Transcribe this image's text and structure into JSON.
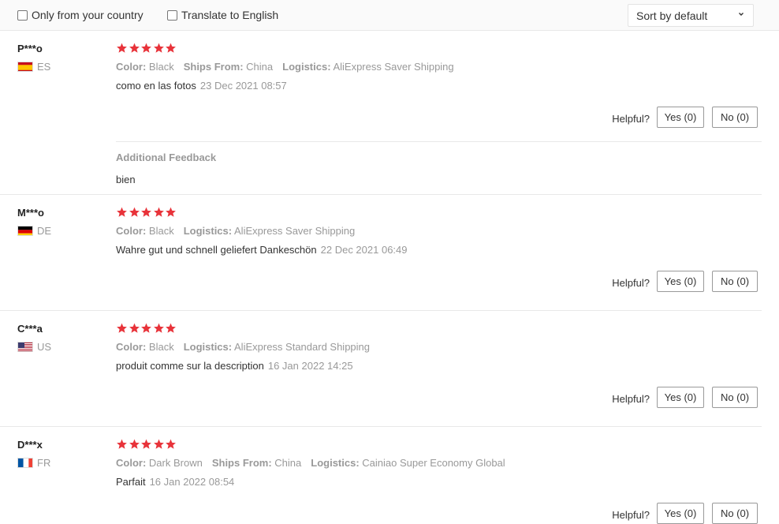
{
  "filters": {
    "only_country_label": "Only from your country",
    "translate_label": "Translate to English",
    "sort_value": "Sort by default"
  },
  "helpful_label": "Helpful?",
  "colors": {
    "star": "#e8333a",
    "muted": "#999999",
    "border": "#e8e8e8"
  },
  "reviews": [
    {
      "name": "P***o",
      "country": "ES",
      "flag_icon": "spain-flag-icon",
      "rating": 5,
      "attrs": [
        {
          "key": "Color:",
          "value": "Black"
        },
        {
          "key": "Ships From:",
          "value": "China"
        },
        {
          "key": "Logistics:",
          "value": "AliExpress Saver Shipping"
        }
      ],
      "text": "como en las fotos",
      "date": "23 Dec 2021 08:57",
      "yes": "Yes (0)",
      "no": "No (0)",
      "additional_title": "Additional Feedback",
      "additional_text": "bien"
    },
    {
      "name": "M***o",
      "country": "DE",
      "flag_icon": "germany-flag-icon",
      "rating": 5,
      "attrs": [
        {
          "key": "Color:",
          "value": "Black"
        },
        {
          "key": "Logistics:",
          "value": "AliExpress Saver Shipping"
        }
      ],
      "text": "Wahre gut und schnell geliefert Dankeschön",
      "date": "22 Dec 2021 06:49",
      "yes": "Yes (0)",
      "no": "No (0)"
    },
    {
      "name": "C***a",
      "country": "US",
      "flag_icon": "usa-flag-icon",
      "rating": 5,
      "attrs": [
        {
          "key": "Color:",
          "value": "Black"
        },
        {
          "key": "Logistics:",
          "value": "AliExpress Standard Shipping"
        }
      ],
      "text": "produit comme sur la description",
      "date": "16 Jan 2022 14:25",
      "yes": "Yes (0)",
      "no": "No (0)"
    },
    {
      "name": "D***x",
      "country": "FR",
      "flag_icon": "france-flag-icon",
      "rating": 5,
      "attrs": [
        {
          "key": "Color:",
          "value": "Dark Brown"
        },
        {
          "key": "Ships From:",
          "value": "China"
        },
        {
          "key": "Logistics:",
          "value": "Cainiao Super Economy Global"
        }
      ],
      "text": "Parfait",
      "date": "16 Jan 2022 08:54",
      "yes": "Yes (0)",
      "no": "No (0)"
    }
  ]
}
